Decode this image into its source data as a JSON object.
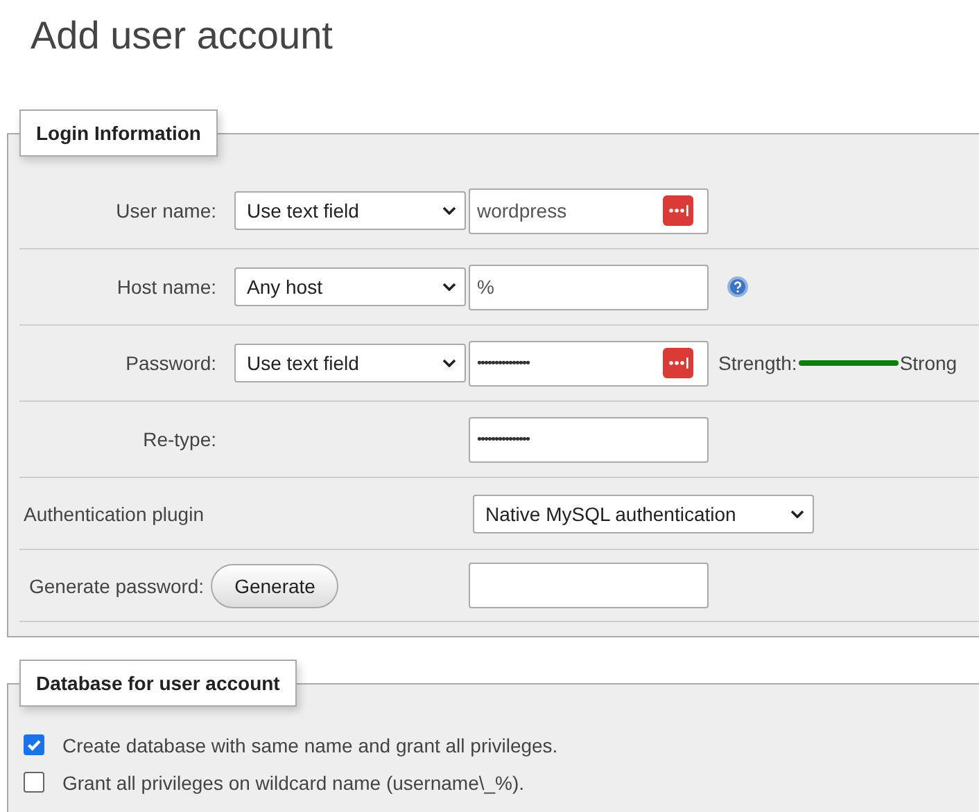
{
  "title": "Add user account",
  "login": {
    "legend": "Login Information",
    "rows": [
      {
        "kind": "field",
        "label": "User name:",
        "select": "Use text field",
        "value": "wordpress",
        "autofill_button": true
      },
      {
        "kind": "field",
        "label": "Host name:",
        "select": "Any host",
        "value": "%",
        "help": true
      },
      {
        "kind": "field",
        "label": "Password:",
        "select": "Use text field",
        "value": "•••••••••••••••",
        "masked": true,
        "autofill_button": true,
        "strength": {
          "label": "Strength:",
          "text": "Strong"
        }
      },
      {
        "kind": "field",
        "label": "Re-type:",
        "value": "•••••••••••••••",
        "masked": true
      },
      {
        "kind": "plugin",
        "label": "Authentication plugin",
        "select": "Native MySQL authentication"
      },
      {
        "kind": "generate",
        "label": "Generate password:",
        "button": "Generate"
      }
    ]
  },
  "database": {
    "legend": "Database for user account",
    "options": [
      {
        "label": "Create database with same name and grant all privileges.",
        "checked": true
      },
      {
        "label": "Grant all privileges on wildcard name (username\\_%).",
        "checked": false
      }
    ]
  }
}
